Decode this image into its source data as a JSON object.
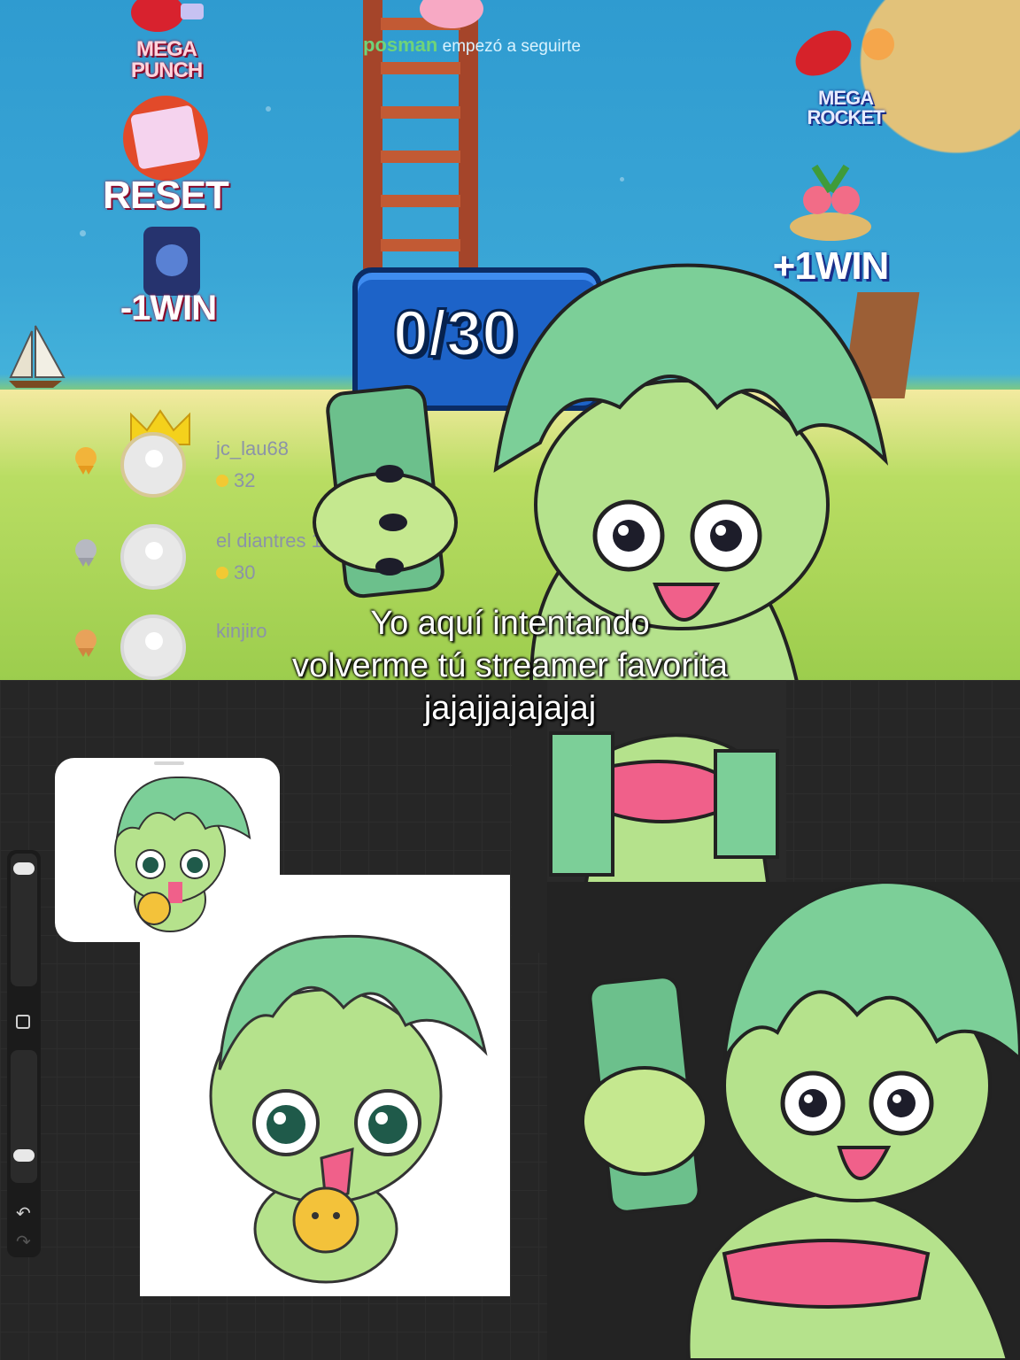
{
  "stream": {
    "follow_toast": {
      "user": "posman",
      "message": "empezó a seguirte"
    },
    "gifts_left": [
      {
        "label": "MEGA PUNCH",
        "icon": "boxing-glove-icon"
      },
      {
        "label": "RESET",
        "icon": "tiktok-box-icon"
      },
      {
        "label": "-1WIN",
        "icon": "galaxy-icon"
      }
    ],
    "gifts_right": [
      {
        "label": "MEGA ROCKET",
        "icon": "rocket-corgi-icon"
      },
      {
        "label": "+1WIN",
        "icon": "island-icon"
      }
    ],
    "counter": "0/30",
    "leaderboard": [
      {
        "rank": 1,
        "name": "jc_lau68",
        "coins": "32"
      },
      {
        "rank": 2,
        "name": "el diantres 123",
        "coins": "30"
      },
      {
        "rank": 3,
        "name": "kinjiro",
        "coins": ""
      }
    ]
  },
  "caption": {
    "line1": "Yo aquí intentando",
    "line2": "volverme tú streamer favorita",
    "line3": "jajajjajajajaj"
  },
  "colors": {
    "character_green": "#7ccf98",
    "skin_green": "#b5e28c",
    "top_pink": "#f0608a",
    "canvas_dark": "#262626"
  }
}
